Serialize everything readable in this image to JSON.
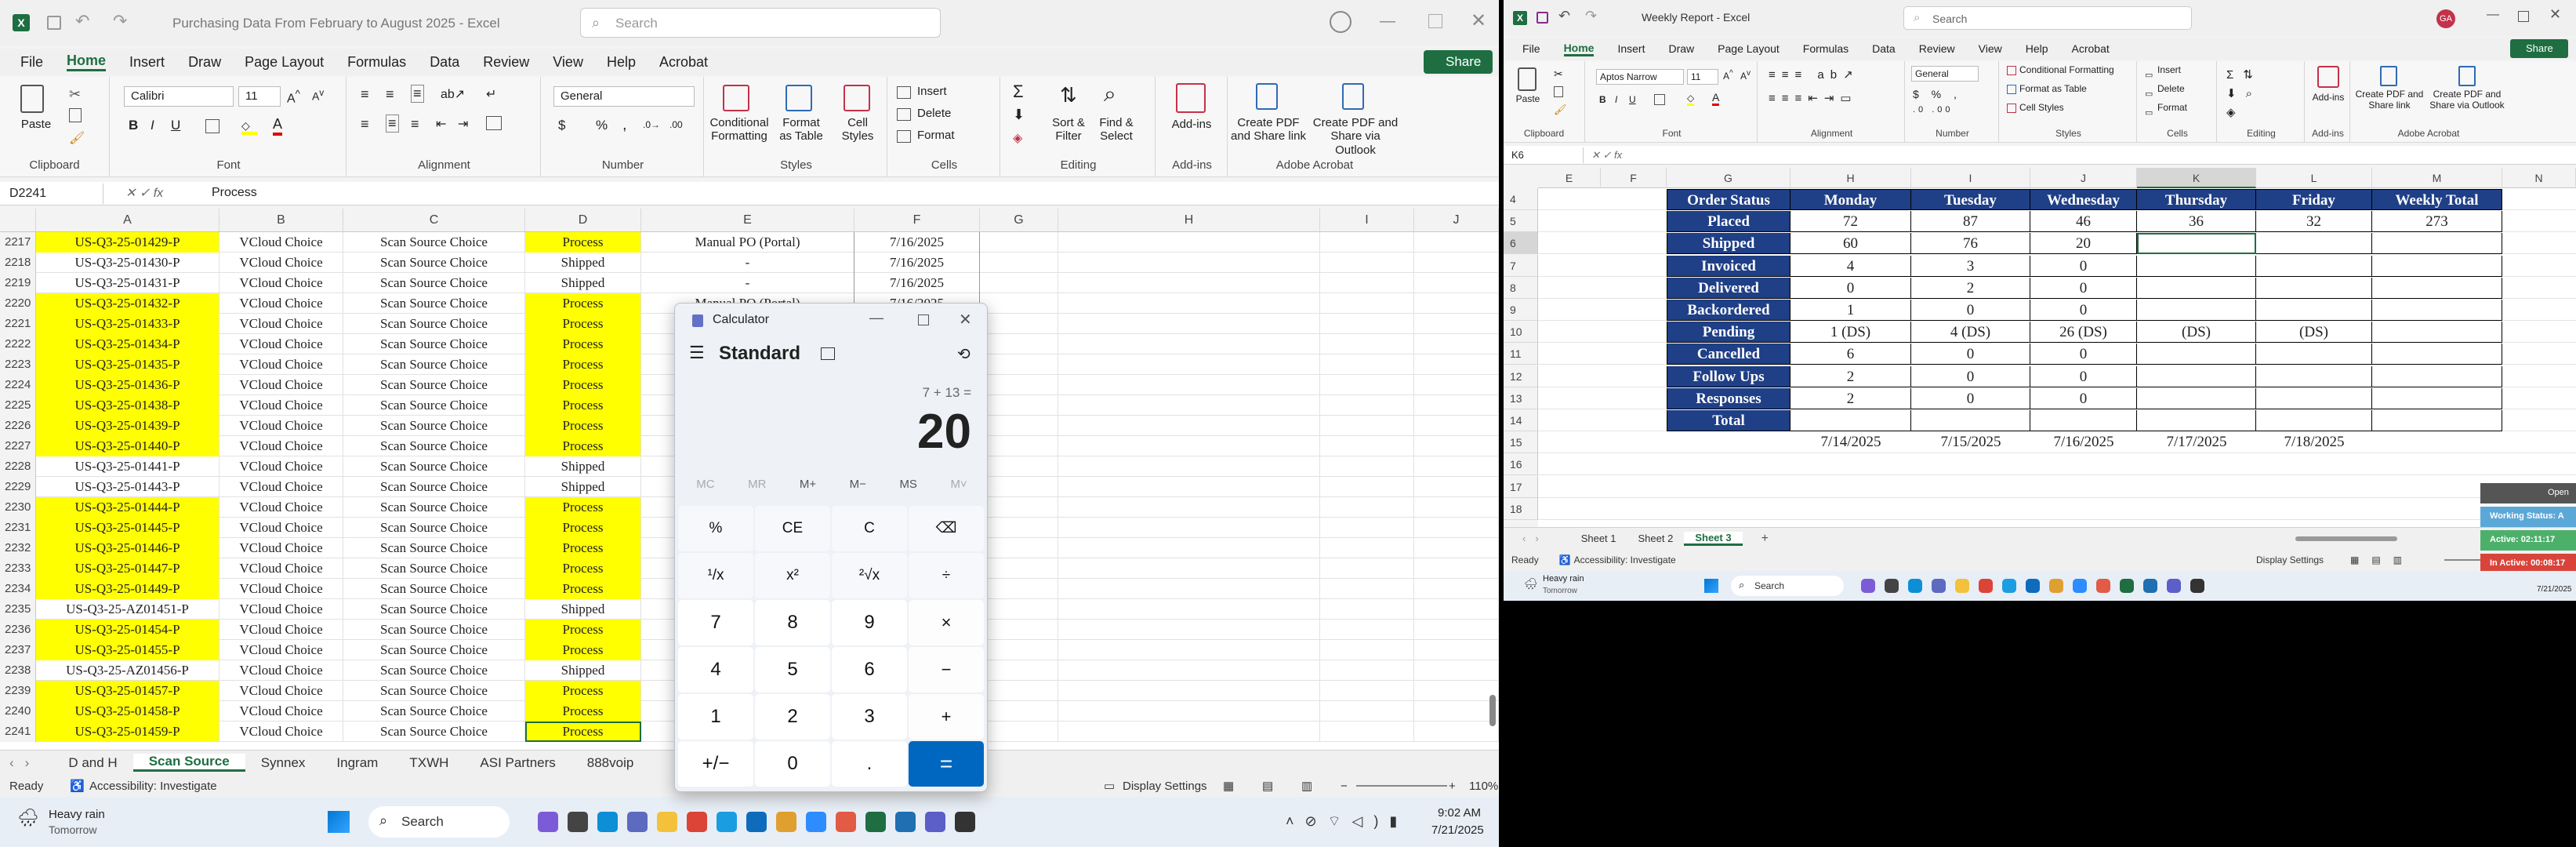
{
  "left_excel": {
    "title": "Purchasing Data From February to August 2025 - Excel",
    "search_placeholder": "Search",
    "share_label": "Share",
    "menu": [
      "File",
      "Home",
      "Insert",
      "Draw",
      "Page Layout",
      "Formulas",
      "Data",
      "Review",
      "View",
      "Help",
      "Acrobat"
    ],
    "ribbon": {
      "paste": "Paste",
      "clipboard": "Clipboard",
      "font_name": "Calibri",
      "font_size": "11",
      "font": "Font",
      "alignment": "Alignment",
      "number_format": "General",
      "number": "Number",
      "conditional_formatting": "Conditional Formatting",
      "format_as_table": "Format as Table",
      "cell_styles": "Cell Styles",
      "styles": "Styles",
      "insert": "Insert",
      "delete": "Delete",
      "format": "Format",
      "cells": "Cells",
      "sort_filter": "Sort & Filter",
      "find_select": "Find & Select",
      "editing": "Editing",
      "addins": "Add-ins",
      "addins_group": "Add-ins",
      "create_pdf": "Create PDF and Share link",
      "create_pdf_outlook": "Create PDF and Share via Outlook",
      "acrobat_group": "Adobe Acrobat"
    },
    "name_box": "D2241",
    "formula": "Process",
    "columns": [
      "A",
      "B",
      "C",
      "D",
      "E",
      "F",
      "G",
      "H",
      "I",
      "J"
    ],
    "rows": [
      {
        "n": "2217",
        "a": "US-Q3-25-01429-P",
        "b": "VCloud Choice",
        "c": "Scan Source Choice",
        "d": "Process",
        "e": "Manual PO (Portal)",
        "f": "7/16/2025",
        "y": true
      },
      {
        "n": "2218",
        "a": "US-Q3-25-01430-P",
        "b": "VCloud Choice",
        "c": "Scan Source Choice",
        "d": "Shipped",
        "e": "-",
        "f": "7/16/2025",
        "y": false
      },
      {
        "n": "2219",
        "a": "US-Q3-25-01431-P",
        "b": "VCloud Choice",
        "c": "Scan Source Choice",
        "d": "Shipped",
        "e": "-",
        "f": "7/16/2025",
        "y": false
      },
      {
        "n": "2220",
        "a": "US-Q3-25-01432-P",
        "b": "VCloud Choice",
        "c": "Scan Source Choice",
        "d": "Process",
        "e": "Manual PO (Portal)",
        "f": "7/16/2025",
        "y": true
      },
      {
        "n": "2221",
        "a": "US-Q3-25-01433-P",
        "b": "VCloud Choice",
        "c": "Scan Source Choice",
        "d": "Process",
        "e": "",
        "f": "",
        "y": true
      },
      {
        "n": "2222",
        "a": "US-Q3-25-01434-P",
        "b": "VCloud Choice",
        "c": "Scan Source Choice",
        "d": "Process",
        "e": "",
        "f": "",
        "y": true
      },
      {
        "n": "2223",
        "a": "US-Q3-25-01435-P",
        "b": "VCloud Choice",
        "c": "Scan Source Choice",
        "d": "Process",
        "e": "",
        "f": "",
        "y": true
      },
      {
        "n": "2224",
        "a": "US-Q3-25-01436-P",
        "b": "VCloud Choice",
        "c": "Scan Source Choice",
        "d": "Process",
        "e": "",
        "f": "",
        "y": true
      },
      {
        "n": "2225",
        "a": "US-Q3-25-01438-P",
        "b": "VCloud Choice",
        "c": "Scan Source Choice",
        "d": "Process",
        "e": "",
        "f": "",
        "y": true
      },
      {
        "n": "2226",
        "a": "US-Q3-25-01439-P",
        "b": "VCloud Choice",
        "c": "Scan Source Choice",
        "d": "Process",
        "e": "",
        "f": "",
        "y": true
      },
      {
        "n": "2227",
        "a": "US-Q3-25-01440-P",
        "b": "VCloud Choice",
        "c": "Scan Source Choice",
        "d": "Process",
        "e": "",
        "f": "",
        "y": true
      },
      {
        "n": "2228",
        "a": "US-Q3-25-01441-P",
        "b": "VCloud Choice",
        "c": "Scan Source Choice",
        "d": "Shipped",
        "e": "",
        "f": "",
        "y": false
      },
      {
        "n": "2229",
        "a": "US-Q3-25-01443-P",
        "b": "VCloud Choice",
        "c": "Scan Source Choice",
        "d": "Shipped",
        "e": "",
        "f": "",
        "y": false
      },
      {
        "n": "2230",
        "a": "US-Q3-25-01444-P",
        "b": "VCloud Choice",
        "c": "Scan Source Choice",
        "d": "Process",
        "e": "",
        "f": "",
        "y": true
      },
      {
        "n": "2231",
        "a": "US-Q3-25-01445-P",
        "b": "VCloud Choice",
        "c": "Scan Source Choice",
        "d": "Process",
        "e": "",
        "f": "",
        "y": true
      },
      {
        "n": "2232",
        "a": "US-Q3-25-01446-P",
        "b": "VCloud Choice",
        "c": "Scan Source Choice",
        "d": "Process",
        "e": "",
        "f": "",
        "y": true
      },
      {
        "n": "2233",
        "a": "US-Q3-25-01447-P",
        "b": "VCloud Choice",
        "c": "Scan Source Choice",
        "d": "Process",
        "e": "",
        "f": "",
        "y": true
      },
      {
        "n": "2234",
        "a": "US-Q3-25-01449-P",
        "b": "VCloud Choice",
        "c": "Scan Source Choice",
        "d": "Process",
        "e": "",
        "f": "",
        "y": true
      },
      {
        "n": "2235",
        "a": "US-Q3-25-AZ01451-P",
        "b": "VCloud Choice",
        "c": "Scan Source Choice",
        "d": "Shipped",
        "e": "",
        "f": "",
        "y": false
      },
      {
        "n": "2236",
        "a": "US-Q3-25-01454-P",
        "b": "VCloud Choice",
        "c": "Scan Source Choice",
        "d": "Process",
        "e": "",
        "f": "",
        "y": true
      },
      {
        "n": "2237",
        "a": "US-Q3-25-01455-P",
        "b": "VCloud Choice",
        "c": "Scan Source Choice",
        "d": "Process",
        "e": "",
        "f": "",
        "y": true
      },
      {
        "n": "2238",
        "a": "US-Q3-25-AZ01456-P",
        "b": "VCloud Choice",
        "c": "Scan Source Choice",
        "d": "Shipped",
        "e": "",
        "f": "",
        "y": false
      },
      {
        "n": "2239",
        "a": "US-Q3-25-01457-P",
        "b": "VCloud Choice",
        "c": "Scan Source Choice",
        "d": "Process",
        "e": "",
        "f": "",
        "y": true
      },
      {
        "n": "2240",
        "a": "US-Q3-25-01458-P",
        "b": "VCloud Choice",
        "c": "Scan Source Choice",
        "d": "Process",
        "e": "",
        "f": "",
        "y": true
      },
      {
        "n": "2241",
        "a": "US-Q3-25-01459-P",
        "b": "VCloud Choice",
        "c": "Scan Source Choice",
        "d": "Process",
        "e": "",
        "f": "",
        "y": true
      }
    ],
    "sheet_tabs": [
      "D and H",
      "Scan Source",
      "Synnex",
      "Ingram",
      "TXWH",
      "ASI Partners",
      "888voip"
    ],
    "active_tab": "Scan Source",
    "status_ready": "Ready",
    "accessibility": "Accessibility: Investigate",
    "display_settings": "Display Settings",
    "zoom": "110%"
  },
  "calculator": {
    "title": "Calculator",
    "mode": "Standard",
    "expression": "7 + 13 =",
    "result": "20",
    "memory": [
      "MC",
      "MR",
      "M+",
      "M−",
      "MS",
      "M˅"
    ],
    "keys": [
      "%",
      "CE",
      "C",
      "⌫",
      "¹/x",
      "x²",
      "²√x",
      "÷",
      "7",
      "8",
      "9",
      "×",
      "4",
      "5",
      "6",
      "−",
      "1",
      "2",
      "3",
      "+",
      "+/−",
      "0",
      ".",
      "="
    ]
  },
  "right_excel": {
    "title": "Weekly Report - Excel",
    "search_placeholder": "Search",
    "share_label": "Share",
    "avatar": "GA",
    "menu": [
      "File",
      "Home",
      "Insert",
      "Draw",
      "Page Layout",
      "Formulas",
      "Data",
      "Review",
      "View",
      "Help",
      "Acrobat"
    ],
    "ribbon": {
      "paste": "Paste",
      "clipboard": "Clipboard",
      "font_name": "Aptos Narrow",
      "font_size": "11",
      "font": "Font",
      "alignment": "Alignment",
      "number_format": "General",
      "number": "Number",
      "conditional_formatting": "Conditional Formatting",
      "format_as_table": "Format as Table",
      "cell_styles": "Cell Styles",
      "styles": "Styles",
      "insert": "Insert",
      "delete": "Delete",
      "format": "Format",
      "cells": "Cells",
      "editing": "Editing",
      "addins": "Add-ins",
      "addins_group": "Add-ins",
      "create_pdf": "Create PDF and Share link",
      "create_pdf_outlook": "Create PDF and Share via Outlook",
      "acrobat_group": "Adobe Acrobat"
    },
    "name_box": "K6",
    "columns": [
      "E",
      "F",
      "G",
      "H",
      "I",
      "J",
      "K",
      "L",
      "M",
      "N"
    ],
    "row_numbers": [
      "4",
      "5",
      "6",
      "7",
      "8",
      "9",
      "10",
      "11",
      "12",
      "13",
      "14",
      "15",
      "16",
      "17",
      "18"
    ],
    "table_header": [
      "Order Status",
      "Monday",
      "Tuesday",
      "Wednesday",
      "Thursday",
      "Friday",
      "Weekly Total"
    ],
    "table_rows": [
      [
        "Placed",
        "72",
        "87",
        "46",
        "36",
        "32",
        "273"
      ],
      [
        "Shipped",
        "60",
        "76",
        "20",
        "",
        "",
        ""
      ],
      [
        "Invoiced",
        "4",
        "3",
        "0",
        "",
        "",
        ""
      ],
      [
        "Delivered",
        "0",
        "2",
        "0",
        "",
        "",
        ""
      ],
      [
        "Backordered",
        "1",
        "0",
        "0",
        "",
        "",
        ""
      ],
      [
        "Pending",
        "1 (DS)",
        "4 (DS)",
        "26 (DS)",
        "(DS)",
        "(DS)",
        ""
      ],
      [
        "Cancelled",
        "6",
        "0",
        "0",
        "",
        "",
        ""
      ],
      [
        "Follow Ups",
        "2",
        "0",
        "0",
        "",
        "",
        ""
      ],
      [
        "Responses",
        "2",
        "0",
        "0",
        "",
        "",
        ""
      ],
      [
        "Total",
        "",
        "",
        "",
        "",
        "",
        ""
      ]
    ],
    "dates": [
      "7/14/2025",
      "7/15/2025",
      "7/16/2025",
      "7/17/2025",
      "7/18/2025"
    ],
    "sheet_tabs": [
      "Sheet 1",
      "Sheet 2",
      "Sheet 3"
    ],
    "active_tab": "Sheet 3",
    "status_ready": "Ready",
    "accessibility": "Accessibility: Investigate",
    "display_settings": "Display Settings"
  },
  "widget": {
    "open": "Open",
    "working": "Working Status: A",
    "active": "Active: 02:11:17",
    "inactive": "In Active: 00:08:17"
  },
  "taskbar_left": {
    "weather_title": "Heavy rain",
    "weather_sub": "Tomorrow",
    "search": "Search",
    "time": "9:02 AM",
    "date": "7/21/2025"
  },
  "taskbar_right": {
    "weather_title": "Heavy rain",
    "weather_sub": "Tomorrow",
    "search": "Search",
    "date": "7/21/2025"
  },
  "colors": {
    "excel_green": "#1e6e42",
    "highlight_yellow": "#ffff00",
    "table_blue": "#1f3f86",
    "calc_accent": "#0067c0"
  }
}
